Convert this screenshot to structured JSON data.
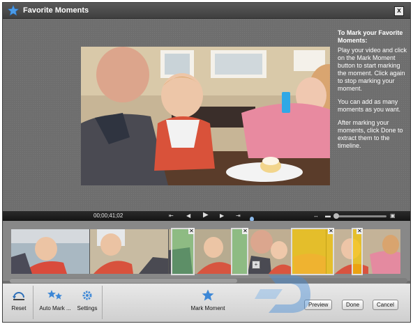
{
  "window": {
    "title": "Favorite Moments",
    "close_label": "x"
  },
  "help": {
    "heading": "To Mark your Favorite Moments:",
    "paragraphs": [
      "Play your video and click on the Mark Moment button to start marking the moment. Click again to stop marking your moment.",
      "You can add as many moments as you want.",
      "After marking your moments, click Done to extract them to the timeline."
    ]
  },
  "player": {
    "timecode": "00;00;41;02",
    "buttons": [
      "go-to-start",
      "step-back",
      "play",
      "step-forward",
      "go-to-end"
    ]
  },
  "toolbar": {
    "reset_label": "Reset",
    "auto_mark_label": "Auto Mark ...",
    "settings_label": "Settings",
    "mark_moment_label": "Mark Moment",
    "preview_label": "Preview",
    "done_label": "Done",
    "cancel_label": "Cancel"
  },
  "colors": {
    "accent": "#3c87d6",
    "selection_green": "#7ac77a",
    "selection_yellow": "#f2c200"
  }
}
